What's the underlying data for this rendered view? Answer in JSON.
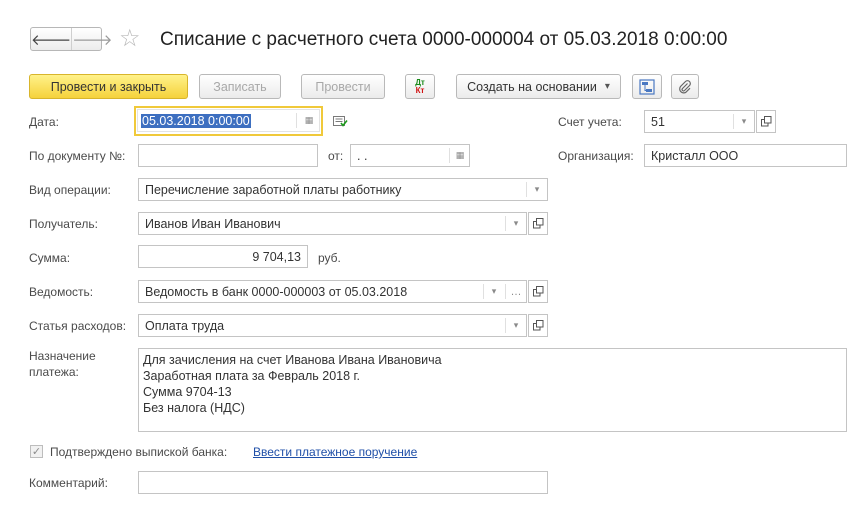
{
  "nav": {
    "back_icon": "arrow-left-icon",
    "forward_icon": "arrow-right-icon",
    "star_icon": "star-icon"
  },
  "title": "Списание с расчетного счета 0000-000004 от 05.03.2018 0:00:00",
  "toolbar": {
    "post_close": "Провести и закрыть",
    "save": "Записать",
    "post": "Провести",
    "dt": "Дт",
    "kt": "Кт",
    "create_based": "Создать на основании",
    "create_based_arrow": "▾"
  },
  "form": {
    "date_label": "Дата:",
    "date_value": "05.03.2018  0:00:00",
    "doc_no_label": "По документу №:",
    "doc_no_value": "",
    "from_label": "от:",
    "from_value": " .  .",
    "account_label": "Счет учета:",
    "account_value": "51",
    "org_label": "Организация:",
    "org_value": "Кристалл ООО",
    "operation_label": "Вид операции:",
    "operation_value": "Перечисление заработной платы работнику",
    "recipient_label": "Получатель:",
    "recipient_value": "Иванов Иван Иванович",
    "sum_label": "Сумма:",
    "sum_value": "9 704,13",
    "currency": "руб.",
    "statement_label": "Ведомость:",
    "statement_value": "Ведомость в банк 0000-000003 от 05.03.2018",
    "expense_label": "Статья расходов:",
    "expense_value": "Оплата труда",
    "purpose_label_1": "Назначение",
    "purpose_label_2": "платежа:",
    "purpose_lines": [
      "Для зачисления на счет Иванова Ивана Ивановича",
      "Заработная плата за Февраль 2018 г.",
      "Сумма 9704-13",
      "Без налога (НДС)"
    ],
    "confirmed_label": "Подтверждено выпиской банка:",
    "confirmed_checked": true,
    "enter_order_link": "Ввести платежное поручение",
    "comment_label": "Комментарий:",
    "comment_value": ""
  },
  "colors": {
    "primary_button": "#f5d23c",
    "focus_border": "#f0c93a",
    "link": "#1f4fa8",
    "selection": "#3d6fc0"
  }
}
